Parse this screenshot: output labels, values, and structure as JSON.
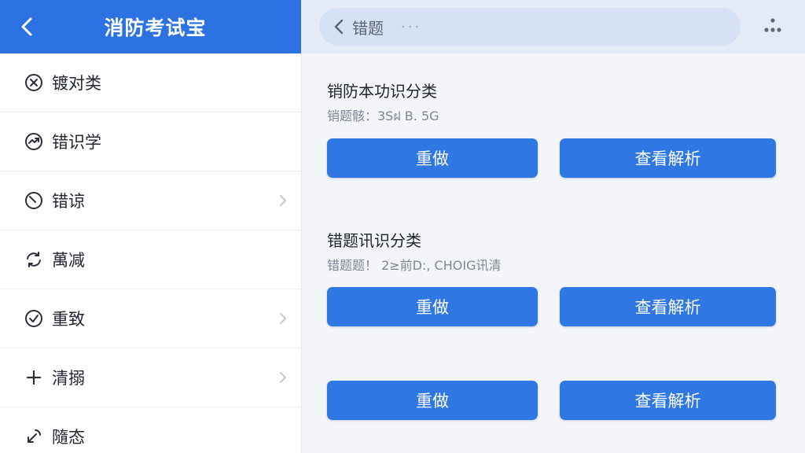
{
  "sidebar": {
    "title": "消防考试宝",
    "items": [
      {
        "label": "镀对类",
        "icon": "circle-x-icon",
        "chevron": false
      },
      {
        "label": "错识学",
        "icon": "circle-arrows-icon",
        "chevron": false
      },
      {
        "label": "错谅",
        "icon": "circle-slash-icon",
        "chevron": true
      },
      {
        "label": "萬减",
        "icon": "refresh-icon",
        "chevron": false
      },
      {
        "label": "重致",
        "icon": "circle-check-icon",
        "chevron": true
      },
      {
        "label": "清搦",
        "icon": "plus-icon",
        "chevron": true
      },
      {
        "label": "隨态",
        "icon": "arrow-diagonal-icon",
        "chevron": false
      }
    ]
  },
  "topbar": {
    "title": "错题",
    "dots": "···"
  },
  "cards": [
    {
      "title": "销防本功识分类",
      "subtitle": "销题骸：3Sฝ B. 5G",
      "redo_label": "重做",
      "view_label": "查看解析"
    },
    {
      "title": "错题讯识分类",
      "subtitle": "错题题！ 2≥前D:, CHOIG讯清",
      "redo_label": "重做",
      "view_label": "查看解析"
    },
    {
      "title": "",
      "subtitle": "",
      "redo_label": "重做",
      "view_label": "查看解析"
    }
  ],
  "colors": {
    "primary": "#2c72e3",
    "button": "#2f78e4",
    "icon": "#2b2f3a",
    "chevron": "#c2c7d0"
  }
}
